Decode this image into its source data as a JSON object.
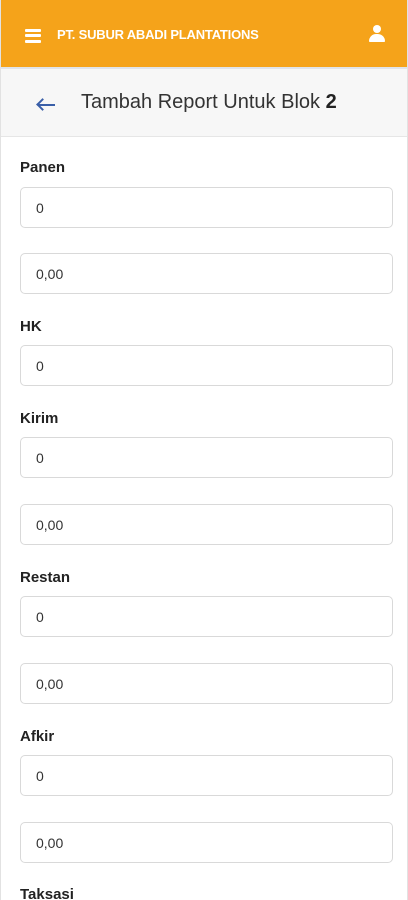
{
  "topbar": {
    "brand": "PT. SUBUR ABADI PLANTATIONS",
    "menu_icon": "hamburger-menu-icon",
    "user_icon": "user-icon",
    "color": "#f5a31a"
  },
  "page_header": {
    "back_icon": "arrow-left-icon",
    "title_prefix": "Tambah Report Untuk Blok ",
    "block_number": "2"
  },
  "form": {
    "panen": {
      "label": "Panen",
      "value_1": "0",
      "value_2": "0,00"
    },
    "hk": {
      "label": "HK",
      "value_1": "0"
    },
    "kirim": {
      "label": "Kirim",
      "value_1": "0",
      "value_2": "0,00"
    },
    "restan": {
      "label": "Restan",
      "value_1": "0",
      "value_2": "0,00"
    },
    "afkir": {
      "label": "Afkir",
      "value_1": "0",
      "value_2": "0,00"
    },
    "taksasi": {
      "label": "Taksasi"
    }
  }
}
